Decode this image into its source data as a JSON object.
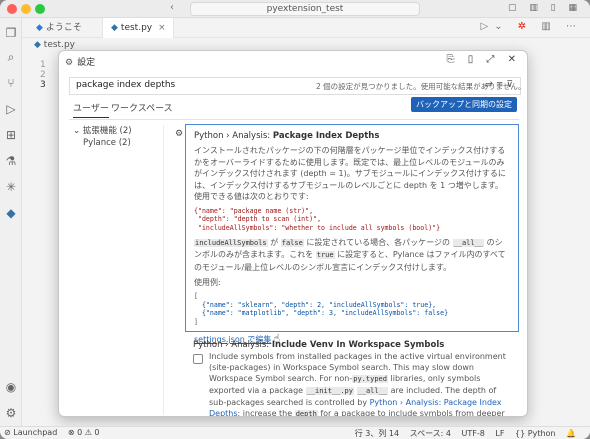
{
  "window": {
    "title": "pyextension_test"
  },
  "tabs": [
    {
      "label": "ようこそ",
      "icon": "vscode-icon"
    },
    {
      "label": "test.py",
      "icon": "python-icon"
    }
  ],
  "breadcrumb": "test.py",
  "gutter": [
    "1",
    "2",
    "3"
  ],
  "settings_dialog": {
    "title": "設定",
    "search_value": "package index depths",
    "search_count": "2 個の設定が見つかりました。使用可能な結果がありません。",
    "scope_user": "ユーザー",
    "scope_workspace": "ワークスペース",
    "backup_button": "バックアップと同期の設定",
    "tree": {
      "group": "拡張機能 (2)",
      "child": "Pylance (2)"
    },
    "setting1": {
      "category": "Python › Analysis: ",
      "name": "Package Index Depths",
      "desc1": "インストールされたパッケージの下の何階層をパッケージ単位でインデックス付けするかをオーバーライドするために使用します。既定では、最上位レベルのモジュールのみがインデックス付けされます (depth = 1)。サブモジュールにインデックス付けするには、インデックス付けするサブモジュールのレベルごとに depth を 1 つ増やします。使用できる値は次のとおりです:",
      "schema_line1": "{\"name\": \"package name (str)\",",
      "schema_line2": " \"depth\": \"depth to scan (int)\",",
      "schema_line3": " \"includeAllSymbols\": \"whether to include all symbols (bool)\"}",
      "p2_part1": "includeAllSymbols",
      "p2_part2": " が ",
      "p2_part3": "false",
      "p2_part4": " に設定されている場合、各パッケージの ",
      "p2_part5": "__all__",
      "p2_part6": " のシンボルのみが含まれます。これを ",
      "p2_part7": "true",
      "p2_part8": " に設定すると、Pylance はファイル内のすべてのモジュール/最上位レベルのシンボル宣言にインデックス付けします。",
      "example_label": "使用例:",
      "ex_open": "[",
      "ex_line1": "  {\"name\": \"sklearn\", \"depth\": 2, \"includeAllSymbols\": true},",
      "ex_line2": "  {\"name\": \"matplotlib\", \"depth\": 3, \"includeAllSymbols\": false}",
      "ex_close": "]",
      "link": "settings.json で編集"
    },
    "setting2": {
      "category": "Python › Analysis: ",
      "name": "Include Venv In Workspace Symbols",
      "desc_a": "Include symbols from installed packages in the active virtual environment (site-packages) in Workspace Symbol search. This may slow down Workspace Symbol search. For non-",
      "code_a": "py.typed",
      "desc_b": " libraries, only symbols exported via a package ",
      "code_b": "__init__.py",
      "code_c": "__all__",
      "desc_c": " are included. The depth of sub-packages searched is controlled by ",
      "link": "Python › Analysis: Package Index Depths",
      "desc_d": "; increase the ",
      "code_d": "depth",
      "desc_e": " for a package to include symbols from deeper sub-modules."
    }
  },
  "statusbar": {
    "left": [
      "⊘ Launchpad",
      "⊗ 0 ⚠ 0"
    ],
    "right": [
      "行 3、列 14",
      "スペース: 4",
      "UTF-8",
      "LF",
      "{} Python"
    ]
  },
  "colors": {
    "accent": "#1f62b9",
    "focus_border": "#4a88d8"
  }
}
